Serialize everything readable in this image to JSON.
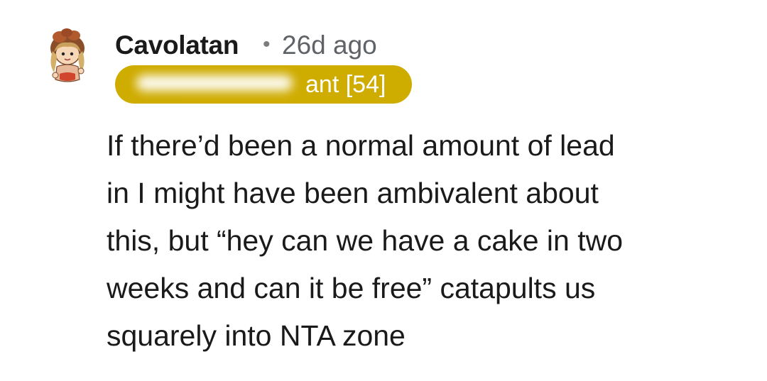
{
  "comment": {
    "author": {
      "username": "Cavolatan",
      "avatar_icon": "snoo-avatar-icon"
    },
    "separator": "•",
    "timestamp": "26d ago",
    "flair": {
      "visible_text": "ant [54]",
      "color": "#cfac00"
    },
    "body_lines": [
      "If there’d been a normal amount of lead",
      "in I might have been ambivalent about",
      "this, but “hey can we have a cake in two",
      "weeks and can it be free” catapults us",
      "squarely into NTA zone"
    ]
  },
  "colors": {
    "text": "#1a1a1b",
    "meta": "#5f6368",
    "flair": "#cfac00"
  }
}
